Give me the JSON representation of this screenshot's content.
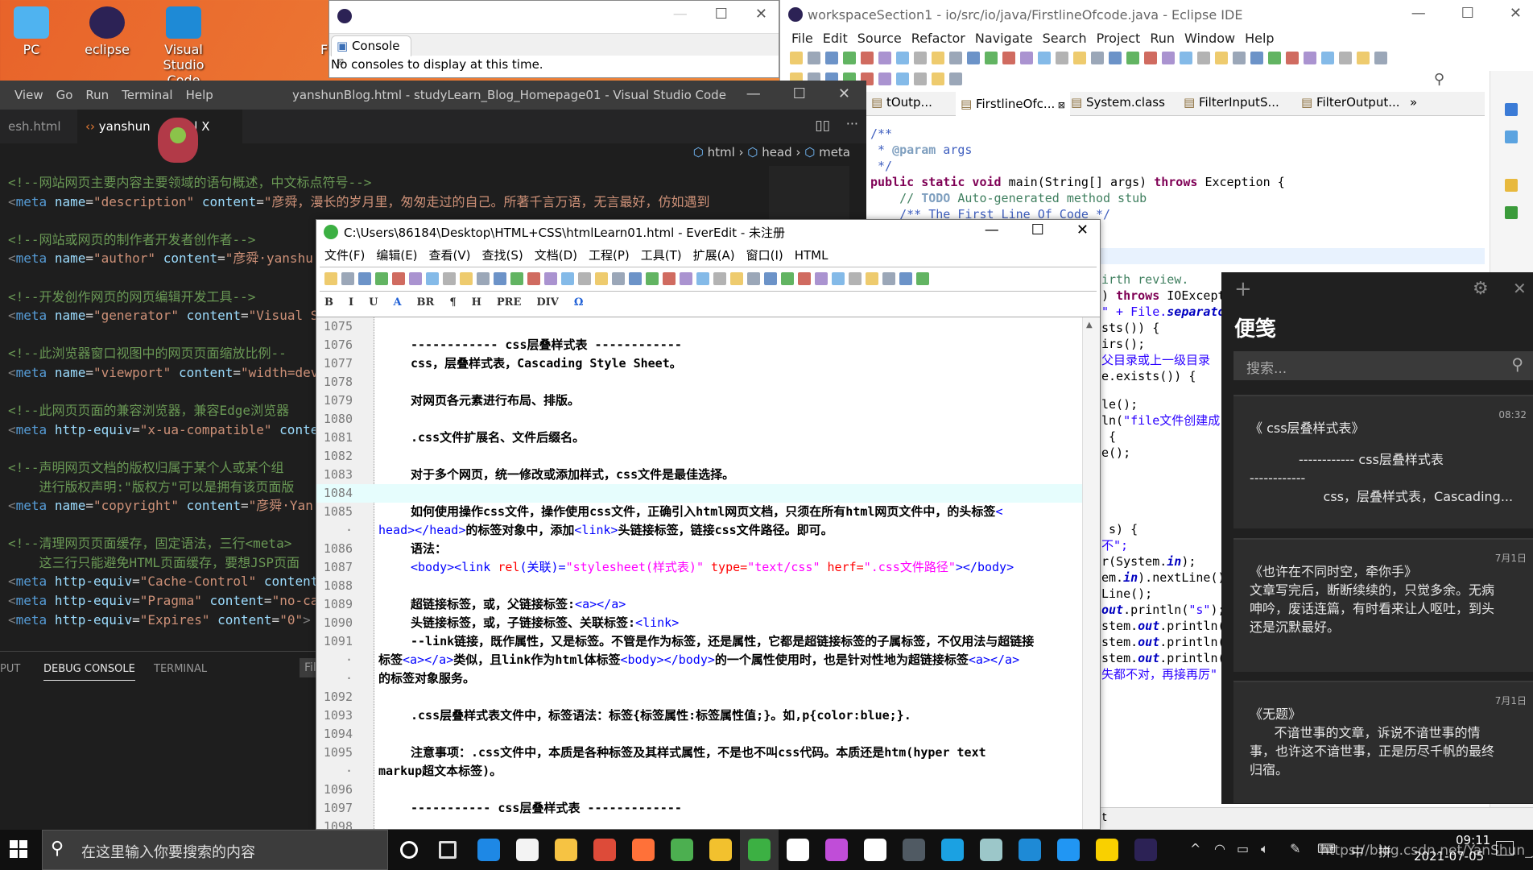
{
  "desktop": {
    "icons": [
      {
        "label": "PC",
        "color": "#4fb3f0"
      },
      {
        "label": "eclipse",
        "color": "#2c2255"
      },
      {
        "label": "Visual Studio Code",
        "color": "#1e8ad6"
      }
    ],
    "partial_label": "F"
  },
  "console_window": {
    "tab": "Console",
    "message": "No consoles to display at this time."
  },
  "eclipse": {
    "title": "workspaceSection1 - io/src/io/java/FirstlineOfcode.java - Eclipse IDE",
    "menu": [
      "File",
      "Edit",
      "Source",
      "Refactor",
      "Navigate",
      "Search",
      "Project",
      "Run",
      "Window",
      "Help"
    ],
    "tabs": [
      "tOutp...",
      "FirstlineOfc...",
      "System.class",
      "FilterInputS...",
      "FilterOutput..."
    ],
    "tabs_overflow": "»",
    "code": [
      [
        {
          "t": "/**",
          "c": "jd"
        }
      ],
      [
        {
          "t": " * ",
          "c": "jd"
        },
        {
          "t": "@param",
          "c": "jt"
        },
        {
          "t": " args",
          "c": "jd"
        }
      ],
      [
        {
          "t": " */",
          "c": "jd"
        }
      ],
      [
        {
          "t": "public static void ",
          "c": "kw"
        },
        {
          "t": "main(String[] args) ",
          "c": ""
        },
        {
          "t": "throws ",
          "c": "kw"
        },
        {
          "t": "Exception {",
          "c": ""
        }
      ],
      [
        {
          "t": "    // ",
          "c": "cm"
        },
        {
          "t": "TODO",
          "c": "jt"
        },
        {
          "t": " Auto-generated method stub",
          "c": "cm"
        }
      ],
      [
        {
          "t": "    /** The First Line Of Code */",
          "c": "jd"
        }
      ]
    ],
    "strip": [
      [
        {
          "t": "irth review.",
          "c": "cm"
        }
      ],
      [
        {
          "t": ") ",
          "c": ""
        },
        {
          "t": "throws ",
          "c": "kw"
        },
        {
          "t": "IOExcept",
          "c": ""
        }
      ],
      [
        {
          "t": "\" + File.",
          "c": "st"
        },
        {
          "t": "separato",
          "c": "fld"
        }
      ],
      [
        {
          "t": "sts()) {",
          "c": ""
        }
      ],
      [
        {
          "t": "irs();",
          "c": ""
        }
      ],
      [
        {
          "t": "父目录或上一级目录",
          "c": "st"
        }
      ],
      [
        {
          "t": "e.exists()) {",
          "c": ""
        }
      ],
      [
        {
          "t": "",
          "c": ""
        }
      ],
      [
        {
          "t": "le();",
          "c": ""
        }
      ],
      [
        {
          "t": "ln(",
          "c": ""
        },
        {
          "t": "\"file文件创建成",
          "c": "st"
        }
      ],
      [
        {
          "t": " {",
          "c": ""
        }
      ],
      [
        {
          "t": "e();",
          "c": ""
        }
      ],
      [
        {
          "t": "",
          "c": ""
        }
      ],
      [
        {
          "t": "",
          "c": ""
        }
      ],
      [
        {
          "t": "",
          "c": ""
        }
      ],
      [
        {
          "t": "",
          "c": ""
        }
      ],
      [
        {
          "t": "",
          "c": ""
        }
      ],
      [
        {
          "t": " s) {",
          "c": ""
        }
      ],
      [
        {
          "t": "不\";",
          "c": "st"
        }
      ],
      [
        {
          "t": "r(System.",
          "c": ""
        },
        {
          "t": "in",
          "c": "fld"
        },
        {
          "t": ");",
          "c": ""
        }
      ],
      [
        {
          "t": "em.",
          "c": ""
        },
        {
          "t": "in",
          "c": "fld"
        },
        {
          "t": ").nextLine()",
          "c": ""
        }
      ],
      [
        {
          "t": "Line();",
          "c": ""
        }
      ],
      [
        {
          "t": "out",
          "c": "fld"
        },
        {
          "t": ".println(",
          "c": ""
        },
        {
          "t": "\"s\"",
          "c": "st"
        },
        {
          "t": ");",
          "c": ""
        }
      ],
      [
        {
          "t": "stem.",
          "c": ""
        },
        {
          "t": "out",
          "c": "fld"
        },
        {
          "t": ".println(",
          "c": ""
        }
      ],
      [
        {
          "t": "stem.",
          "c": ""
        },
        {
          "t": "out",
          "c": "fld"
        },
        {
          "t": ".println(",
          "c": ""
        }
      ],
      [
        {
          "t": "stem.",
          "c": ""
        },
        {
          "t": "out",
          "c": "fld"
        },
        {
          "t": ".println(",
          "c": ""
        }
      ],
      [
        {
          "t": "失都不对，再接再厉\"",
          "c": "st"
        }
      ]
    ],
    "status_fragment": "t"
  },
  "vscode": {
    "menu": [
      "View",
      "Go",
      "Run",
      "Terminal",
      "Help"
    ],
    "title": "yanshunBlog.html - studyLearn_Blog_Homepage01 - Visual Studio Code",
    "tabs": [
      {
        "label": "esh.html"
      },
      {
        "label": "yanshun",
        "suffix": "ml",
        "active": true
      }
    ],
    "close": "X",
    "breadcrumb": [
      "html",
      "head",
      "meta"
    ],
    "panel_tabs": [
      "PUT",
      "DEBUG CONSOLE",
      "TERMINAL"
    ],
    "panel_filter": "Fil",
    "code": [
      [
        {
          "t": "<!--网站网页主要内容主要领域的语句概述，中文标点符号-->",
          "c": "c-cm"
        }
      ],
      [
        {
          "t": "<",
          "c": "c-tg"
        },
        {
          "t": "meta ",
          "c": "c-el"
        },
        {
          "t": "name",
          "c": "c-at"
        },
        {
          "t": "=",
          "c": "c-tx"
        },
        {
          "t": "\"description\" ",
          "c": "c-st"
        },
        {
          "t": "content",
          "c": "c-at"
        },
        {
          "t": "=",
          "c": "c-tx"
        },
        {
          "t": "\"彦舜，漫长的岁月里，匆匆走过的自己。所著千言万语，无言最好，仿如遇到",
          "c": "c-st"
        }
      ],
      [],
      [
        {
          "t": "<!--网站或网页的制作者开发者创作者-->",
          "c": "c-cm"
        }
      ],
      [
        {
          "t": "<",
          "c": "c-tg"
        },
        {
          "t": "meta ",
          "c": "c-el"
        },
        {
          "t": "name",
          "c": "c-at"
        },
        {
          "t": "=",
          "c": "c-tx"
        },
        {
          "t": "\"author\" ",
          "c": "c-st"
        },
        {
          "t": "content",
          "c": "c-at"
        },
        {
          "t": "=",
          "c": "c-tx"
        },
        {
          "t": "\"彦舜·yanshu",
          "c": "c-st"
        }
      ],
      [],
      [
        {
          "t": "<!--开发创作网页的网页编辑开发工具-->",
          "c": "c-cm"
        }
      ],
      [
        {
          "t": "<",
          "c": "c-tg"
        },
        {
          "t": "meta ",
          "c": "c-el"
        },
        {
          "t": "name",
          "c": "c-at"
        },
        {
          "t": "=",
          "c": "c-tx"
        },
        {
          "t": "\"generator\" ",
          "c": "c-st"
        },
        {
          "t": "content",
          "c": "c-at"
        },
        {
          "t": "=",
          "c": "c-tx"
        },
        {
          "t": "\"Visual S",
          "c": "c-st"
        }
      ],
      [],
      [
        {
          "t": "<!--此浏览器窗口视图中的网页页面缩放比例--",
          "c": "c-cm"
        }
      ],
      [
        {
          "t": "<",
          "c": "c-tg"
        },
        {
          "t": "meta ",
          "c": "c-el"
        },
        {
          "t": "name",
          "c": "c-at"
        },
        {
          "t": "=",
          "c": "c-tx"
        },
        {
          "t": "\"viewport\" ",
          "c": "c-st"
        },
        {
          "t": "content",
          "c": "c-at"
        },
        {
          "t": "=",
          "c": "c-tx"
        },
        {
          "t": "\"width=dev",
          "c": "c-st"
        }
      ],
      [],
      [
        {
          "t": "<!--此网页页面的兼容浏览器，兼容Edge浏览器",
          "c": "c-cm"
        }
      ],
      [
        {
          "t": "<",
          "c": "c-tg"
        },
        {
          "t": "meta ",
          "c": "c-el"
        },
        {
          "t": "http-equiv",
          "c": "c-at"
        },
        {
          "t": "=",
          "c": "c-tx"
        },
        {
          "t": "\"x-ua-compatible\" ",
          "c": "c-st"
        },
        {
          "t": "conte",
          "c": "c-at"
        }
      ],
      [],
      [
        {
          "t": "<!--声明网页文档的版权归属于某个人或某个组",
          "c": "c-cm"
        }
      ],
      [
        {
          "t": "    进行版权声明:\"版权方\"可以是拥有该页面版",
          "c": "c-cm"
        }
      ],
      [
        {
          "t": "<",
          "c": "c-tg"
        },
        {
          "t": "meta ",
          "c": "c-el"
        },
        {
          "t": "name",
          "c": "c-at"
        },
        {
          "t": "=",
          "c": "c-tx"
        },
        {
          "t": "\"copyright\" ",
          "c": "c-st"
        },
        {
          "t": "content",
          "c": "c-at"
        },
        {
          "t": "=",
          "c": "c-tx"
        },
        {
          "t": "\"彦舜·Yan",
          "c": "c-st"
        }
      ],
      [],
      [
        {
          "t": "<!--清理网页页面缓存，固定语法，三行<meta>",
          "c": "c-cm"
        }
      ],
      [
        {
          "t": "    这三行只能避免HTML页面缓存，要想JSP页面",
          "c": "c-cm"
        }
      ],
      [
        {
          "t": "<",
          "c": "c-tg"
        },
        {
          "t": "meta ",
          "c": "c-el"
        },
        {
          "t": "http-equiv",
          "c": "c-at"
        },
        {
          "t": "=",
          "c": "c-tx"
        },
        {
          "t": "\"Cache-Control\" ",
          "c": "c-st"
        },
        {
          "t": "content",
          "c": "c-at"
        }
      ],
      [
        {
          "t": "<",
          "c": "c-tg"
        },
        {
          "t": "meta ",
          "c": "c-el"
        },
        {
          "t": "http-equiv",
          "c": "c-at"
        },
        {
          "t": "=",
          "c": "c-tx"
        },
        {
          "t": "\"Pragma\" ",
          "c": "c-st"
        },
        {
          "t": "content",
          "c": "c-at"
        },
        {
          "t": "=",
          "c": "c-tx"
        },
        {
          "t": "\"no-ca",
          "c": "c-st"
        }
      ],
      [
        {
          "t": "<",
          "c": "c-tg"
        },
        {
          "t": "meta ",
          "c": "c-el"
        },
        {
          "t": "http-equiv",
          "c": "c-at"
        },
        {
          "t": "=",
          "c": "c-tx"
        },
        {
          "t": "\"Expires\" ",
          "c": "c-st"
        },
        {
          "t": "content",
          "c": "c-at"
        },
        {
          "t": "=",
          "c": "c-tx"
        },
        {
          "t": "\"0\"",
          "c": "c-st"
        },
        {
          "t": ">",
          "c": "c-tg"
        }
      ]
    ]
  },
  "everedit": {
    "title": "C:\\Users\\86184\\Desktop\\HTML+CSS\\htmlLearn01.html - EverEdit - 未注册",
    "menu": [
      "文件(F)",
      "编辑(E)",
      "查看(V)",
      "查找(S)",
      "文档(D)",
      "工程(P)",
      "工具(T)",
      "扩展(A)",
      "窗口(I)",
      "HTML"
    ],
    "format_toolbar": [
      "B",
      "I",
      "U",
      "A",
      "BR",
      "¶",
      "H",
      "PRE",
      "DIV",
      "Ω"
    ],
    "current_line": "1084",
    "rows": [
      {
        "num": "1075",
        "ind": true,
        "segs": []
      },
      {
        "num": "1076",
        "ind": true,
        "segs": [
          {
            "t": "------------ css层叠样式表 ------------",
            "c": ""
          }
        ]
      },
      {
        "num": "1077",
        "ind": true,
        "segs": [
          {
            "t": "css，层叠样式表，Cascading Style Sheet。",
            "c": ""
          }
        ]
      },
      {
        "num": "1078",
        "ind": true,
        "segs": []
      },
      {
        "num": "1079",
        "ind": true,
        "segs": [
          {
            "t": "对网页各元素进行布局、排版。",
            "c": ""
          }
        ]
      },
      {
        "num": "1080",
        "ind": true,
        "segs": []
      },
      {
        "num": "1081",
        "ind": true,
        "segs": [
          {
            "t": ".css文件扩展名、文件后缀名。",
            "c": ""
          }
        ]
      },
      {
        "num": "1082",
        "ind": true,
        "segs": []
      },
      {
        "num": "1083",
        "ind": true,
        "segs": [
          {
            "t": "对于多个网页，统一修改或添加样式，css文件是最佳选择。",
            "c": ""
          }
        ]
      },
      {
        "num": "1084",
        "ind": true,
        "segs": []
      },
      {
        "num": "1085",
        "ind": true,
        "segs": [
          {
            "t": "如何使用操作css文件，操作使用css文件，正确引入html网页文档，只须在所有html网页文件中，的头标签",
            "c": ""
          },
          {
            "t": "<",
            "c": "s-tag"
          }
        ]
      },
      {
        "num": "·",
        "ind": false,
        "segs": [
          {
            "t": "head></head>",
            "c": "s-tag"
          },
          {
            "t": "的标签对象中，添加",
            "c": ""
          },
          {
            "t": "<link>",
            "c": "s-tag"
          },
          {
            "t": "头链接标签，链接css文件路径。即可。",
            "c": ""
          }
        ]
      },
      {
        "num": "1086",
        "ind": true,
        "segs": [
          {
            "t": "语法：",
            "c": ""
          }
        ]
      },
      {
        "num": "1087",
        "ind": true,
        "segs": [
          {
            "t": "<body><link ",
            "c": "s-tag"
          },
          {
            "t": "rel",
            "c": "s-attr"
          },
          {
            "t": "(关联)=",
            "c": "s-tag"
          },
          {
            "t": "\"stylesheet(样式表)\" ",
            "c": "s-str"
          },
          {
            "t": "type=",
            "c": "s-attr"
          },
          {
            "t": "\"text/css\" ",
            "c": "s-str"
          },
          {
            "t": "herf=",
            "c": "s-attr"
          },
          {
            "t": "\".css文件路径\"",
            "c": "s-str"
          },
          {
            "t": "></body>",
            "c": "s-tag"
          }
        ]
      },
      {
        "num": "1088",
        "ind": true,
        "segs": []
      },
      {
        "num": "1089",
        "ind": true,
        "segs": [
          {
            "t": "超链接标签，或，父链接标签:",
            "c": ""
          },
          {
            "t": "<a></a>",
            "c": "s-tag"
          }
        ]
      },
      {
        "num": "1090",
        "ind": true,
        "segs": [
          {
            "t": "头链接标签，或，子链接标签、关联标签:",
            "c": ""
          },
          {
            "t": "<link>",
            "c": "s-tag"
          }
        ]
      },
      {
        "num": "1091",
        "ind": true,
        "segs": [
          {
            "t": "--link链接，既作属性，又是标签。不管是作为标签，还是属性，它都是超链接标签的子属标签，不仅用法与超链接",
            "c": ""
          }
        ]
      },
      {
        "num": "·",
        "ind": false,
        "segs": [
          {
            "t": "标签",
            "c": ""
          },
          {
            "t": "<a></a>",
            "c": "s-tag"
          },
          {
            "t": "类似，且link作为html体标签",
            "c": ""
          },
          {
            "t": "<body></body>",
            "c": "s-tag"
          },
          {
            "t": "的一个属性使用时，也是针对性地为超链接标签",
            "c": ""
          },
          {
            "t": "<a></a>",
            "c": "s-tag"
          }
        ]
      },
      {
        "num": "·",
        "ind": false,
        "segs": [
          {
            "t": "的标签对象服务。",
            "c": ""
          }
        ]
      },
      {
        "num": "1092",
        "ind": true,
        "segs": []
      },
      {
        "num": "1093",
        "ind": true,
        "segs": [
          {
            "t": ".css层叠样式表文件中，标签语法：标签{标签属性:标签属性值;}。如,p{color:blue;}.",
            "c": ""
          }
        ]
      },
      {
        "num": "1094",
        "ind": true,
        "segs": []
      },
      {
        "num": "1095",
        "ind": true,
        "segs": [
          {
            "t": "注意事项：.css文件中，本质是各种标签及其样式属性，不是也不叫css代码。本质还是htm(hyper text",
            "c": ""
          }
        ]
      },
      {
        "num": "·",
        "ind": false,
        "segs": [
          {
            "t": "markup超文本标签)。",
            "c": ""
          }
        ]
      },
      {
        "num": "1096",
        "ind": true,
        "segs": []
      },
      {
        "num": "1097",
        "ind": true,
        "segs": [
          {
            "t": "----------- css层叠样式表 -------------",
            "c": ""
          }
        ]
      },
      {
        "num": "1098",
        "ind": true,
        "segs": []
      }
    ]
  },
  "sticky": {
    "title": "便笺",
    "search_placeholder": "搜索...",
    "notes": [
      {
        "date": "08:32",
        "lines": [
          "《 css层叠样式表》",
          "",
          "            ------------ css层叠样式表",
          "------------",
          "                  css，层叠样式表，Cascading..."
        ]
      },
      {
        "date": "7月1日",
        "lines": [
          "《也许在不同时空，牵你手》",
          "文章写完后，断断续续的，只觉多余。无病",
          "呻吟，废话连篇，有时看来让人呕吐，到头",
          "还是沉默最好。"
        ]
      },
      {
        "date": "7月1日",
        "lines": [
          "《无题》",
          "      不谙世事的文章，诉说不谙世事的情",
          "事，也许这不谙世事，正是历尽千帆的最终",
          "归宿。"
        ]
      }
    ]
  },
  "taskbar": {
    "search_placeholder": "在这里输入你要搜索的内容",
    "apps": [
      {
        "name": "cortana",
        "color": "#fff"
      },
      {
        "name": "task-view",
        "color": "#ddd"
      },
      {
        "name": "mail",
        "color": "#1e88e5"
      },
      {
        "name": "store",
        "color": "#f3f3f3"
      },
      {
        "name": "file-explorer",
        "color": "#f6c343"
      },
      {
        "name": "chrome",
        "color": "#dd4b39"
      },
      {
        "name": "firefox",
        "color": "#ff7139"
      },
      {
        "name": "leaf-app",
        "color": "#4caf50"
      },
      {
        "name": "help-app",
        "color": "#f2c12e"
      },
      {
        "name": "everedit",
        "color": "#3cb043",
        "active": true
      },
      {
        "name": "settings",
        "color": "#fff"
      },
      {
        "name": "flame-app",
        "color": "#c04dd8"
      },
      {
        "name": "grapes-app",
        "color": "#fff"
      },
      {
        "name": "media-app",
        "color": "#505a63"
      },
      {
        "name": "edge",
        "color": "#1ba1e2"
      },
      {
        "name": "notes-app",
        "color": "#9cc7c9"
      },
      {
        "name": "vscode",
        "color": "#1e8ad6"
      },
      {
        "name": "k-app",
        "color": "#2196f3"
      },
      {
        "name": "sticky-notes",
        "color": "#f9d000"
      },
      {
        "name": "eclipse",
        "color": "#2c2255"
      }
    ],
    "tray": {
      "ime1": "中",
      "ime2": "拼",
      "time": "09:11",
      "date": "2021-07-05"
    },
    "watermark": "https://blog.csdn.net/YanShun_Java"
  }
}
